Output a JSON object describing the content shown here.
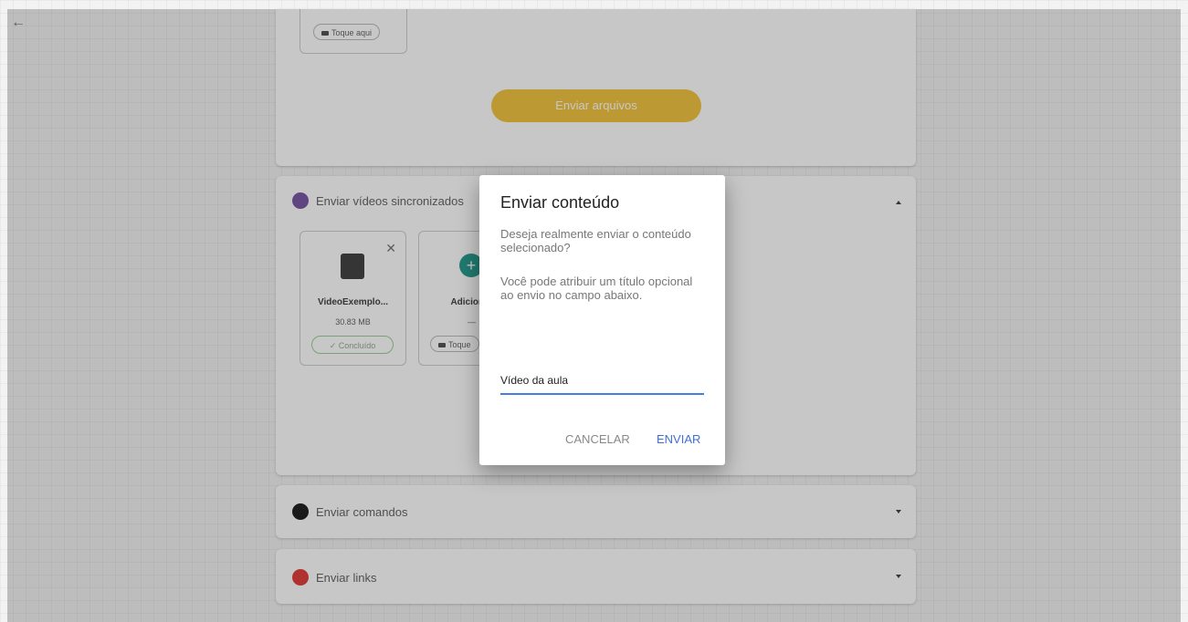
{
  "nav": {
    "back_icon": "arrow-left-icon"
  },
  "top_card": {
    "tap_label": "Toque aqui",
    "send_files_label": "Enviar arquivos",
    "send_files_color": "#f2c542"
  },
  "videos_section": {
    "title": "Enviar vídeos sincronizados",
    "icon_color": "#7b5aa6",
    "file": {
      "name": "VideoExemplo...",
      "size": "30.83 MB",
      "status": "Concluído"
    },
    "add_tile": {
      "label": "Adicionar",
      "dash": "—",
      "tap_label": "Toque"
    }
  },
  "commands_section": {
    "title": "Enviar comandos",
    "icon_color": "#222222"
  },
  "links_section": {
    "title": "Enviar links",
    "icon_color": "#e0403f"
  },
  "dialog": {
    "title": "Enviar conteúdo",
    "text1": "Deseja realmente enviar o conteúdo selecionado?",
    "text2": "Você pode atribuir um título opcional ao envio no campo abaixo.",
    "input_value": "Vídeo da aula",
    "cancel_label": "CANCELAR",
    "send_label": "ENVIAR",
    "accent": "#3f6fd8"
  }
}
